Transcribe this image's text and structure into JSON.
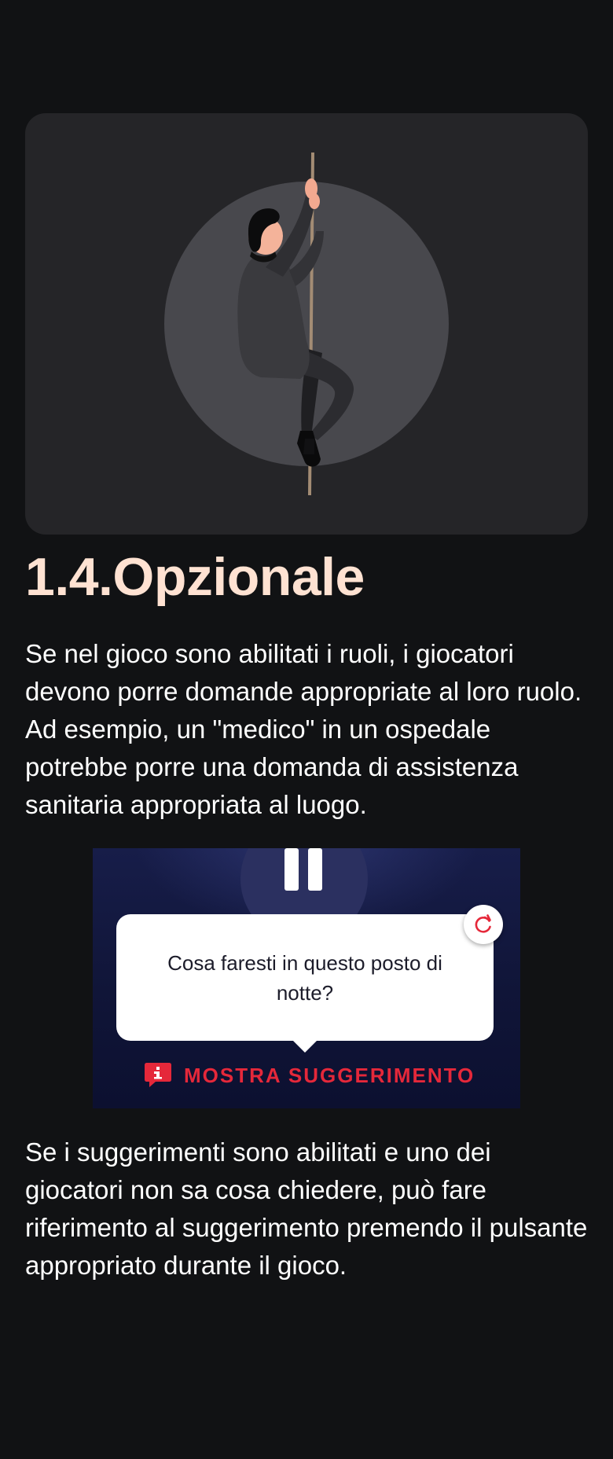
{
  "section": {
    "title": "1.4.Opzionale"
  },
  "paragraphs": {
    "roles": "Se nel gioco sono abilitati i ruoli, i giocatori devono porre domande appropriate al loro ruolo. Ad esempio, un \"medico\" in un ospedale potrebbe porre una domanda di assistenza sanitaria appropriata al luogo.",
    "hints": "Se i suggerimenti sono abilitati e uno dei giocatori non sa cosa chiedere, può fare riferimento al suggerimento premendo il pulsante appropriato durante il gioco."
  },
  "game_screenshot": {
    "question": "Cosa faresti in questo posto di notte?",
    "hint_button_label": "MOSTRA SUGGERIMENTO"
  },
  "icons": {
    "pause": "pause-icon",
    "refresh": "refresh-icon",
    "hint": "info-bubble-icon"
  },
  "colors": {
    "background": "#111214",
    "title": "#ffe2d2",
    "hint_red": "#e5283a",
    "game_bg": "#141a44"
  }
}
